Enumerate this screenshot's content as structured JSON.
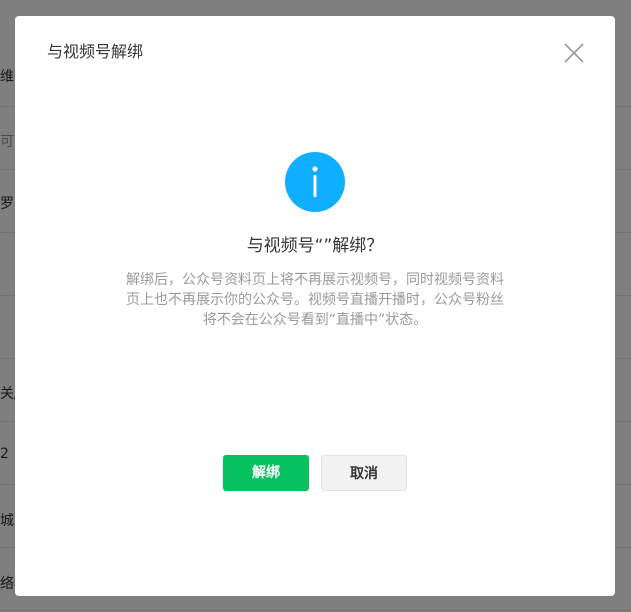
{
  "background": {
    "rows": [
      {
        "text": "维码"
      },
      {
        "text": "可"
      },
      {
        "text": "罗"
      },
      {
        "text": ""
      },
      {
        "text": ""
      },
      {
        "text": "关/"
      },
      {
        "text": "2"
      },
      {
        "text": "城市"
      },
      {
        "text": "络稍"
      }
    ]
  },
  "dialog": {
    "title": "与视频号解绑",
    "heading": "与视频号“”解绑？",
    "description": "解绑后，公众号资料页上将不再展示视频号，同时视频号资料页上也不再展示你的公众号。视频号直播开播时，公众号粉丝将不会在公众号看到“直播中”状态。",
    "confirm_label": "解绑",
    "cancel_label": "取消",
    "icons": {
      "close": "close-icon",
      "info": "info-icon"
    }
  },
  "colors": {
    "primary": "#07c160",
    "info": "#10aeff"
  }
}
